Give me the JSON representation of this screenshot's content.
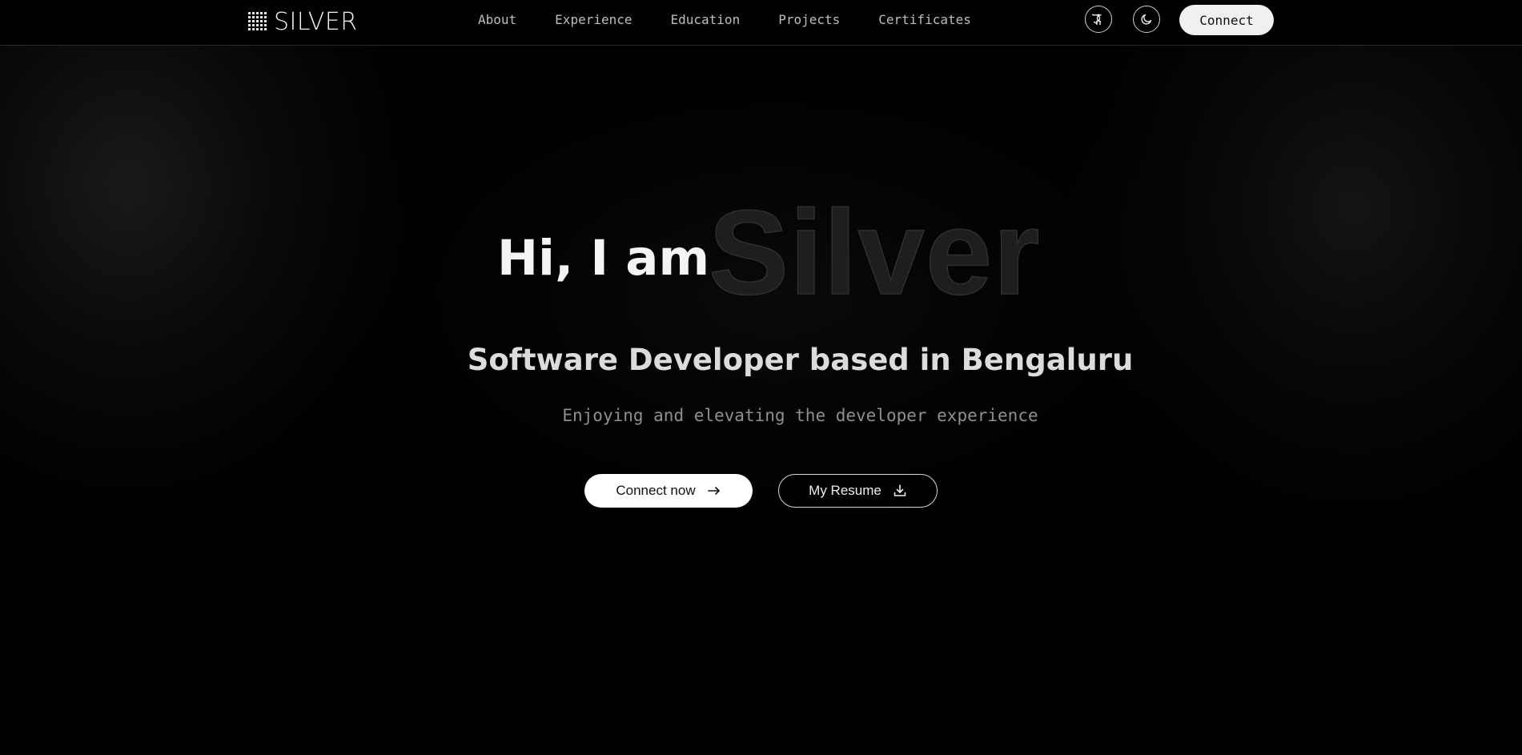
{
  "brand": {
    "name": "SILVER",
    "logo_icon": "grid-dots-icon"
  },
  "nav": {
    "links": [
      "About",
      "Experience",
      "Education",
      "Projects",
      "Certificates"
    ],
    "github_icon": "github-icon",
    "theme_icon": "moon-icon",
    "connect_label": "Connect"
  },
  "hero": {
    "greeting": "Hi, I am",
    "name": "Silver",
    "title": "Software Developer based in Bengaluru",
    "subtitle": "Enjoying and elevating the developer experience",
    "primary_cta": {
      "label": "Connect now",
      "icon": "arrow-right-icon"
    },
    "secondary_cta": {
      "label": "My Resume",
      "icon": "download-icon"
    }
  },
  "colors": {
    "background": "#000000",
    "text": "#f4f4f4",
    "muted": "#8f8f8f",
    "name_outline": "#2e2e2e",
    "pill": "#f0f0f0"
  }
}
